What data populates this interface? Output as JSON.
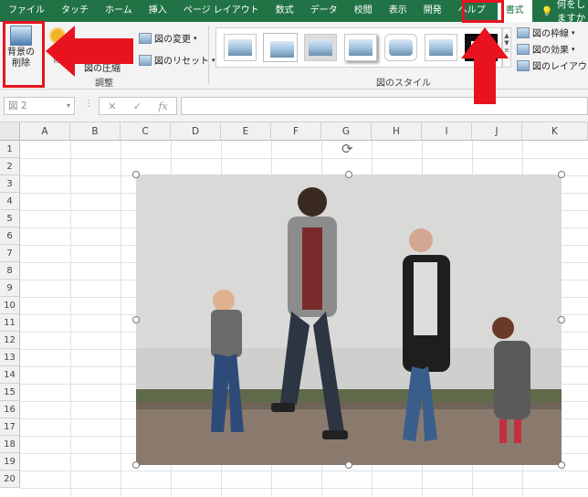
{
  "tabs": [
    "ファイル",
    "タッチ",
    "ホーム",
    "挿入",
    "ページ レイアウト",
    "数式",
    "データ",
    "校閲",
    "表示",
    "開発",
    "ヘルプ",
    "書式"
  ],
  "tell_me": "何をしますか",
  "ribbon": {
    "remove_bg_line1": "背景の",
    "remove_bg_line2": "削除",
    "modify_partial": "修",
    "compress_partial": "図の圧縮",
    "change_picture": "図の変更",
    "reset_picture": "図のリセット",
    "adjust_group": "調整",
    "styles_group": "図のスタイル",
    "picture_border": "図の枠線",
    "picture_effects": "図の効果",
    "picture_layout": "図のレイアウト"
  },
  "formula_bar": {
    "name_box": "図 2",
    "fx": "fx",
    "cancel": "✕",
    "enter": "✓"
  },
  "columns": [
    "A",
    "B",
    "C",
    "D",
    "E",
    "F",
    "G",
    "H",
    "I",
    "J",
    "K"
  ],
  "rows": [
    "1",
    "2",
    "3",
    "4",
    "5",
    "6",
    "7",
    "8",
    "9",
    "10",
    "11",
    "12",
    "13",
    "14",
    "15",
    "16",
    "17",
    "18",
    "19",
    "20"
  ],
  "annotation_color": "#e8131f"
}
